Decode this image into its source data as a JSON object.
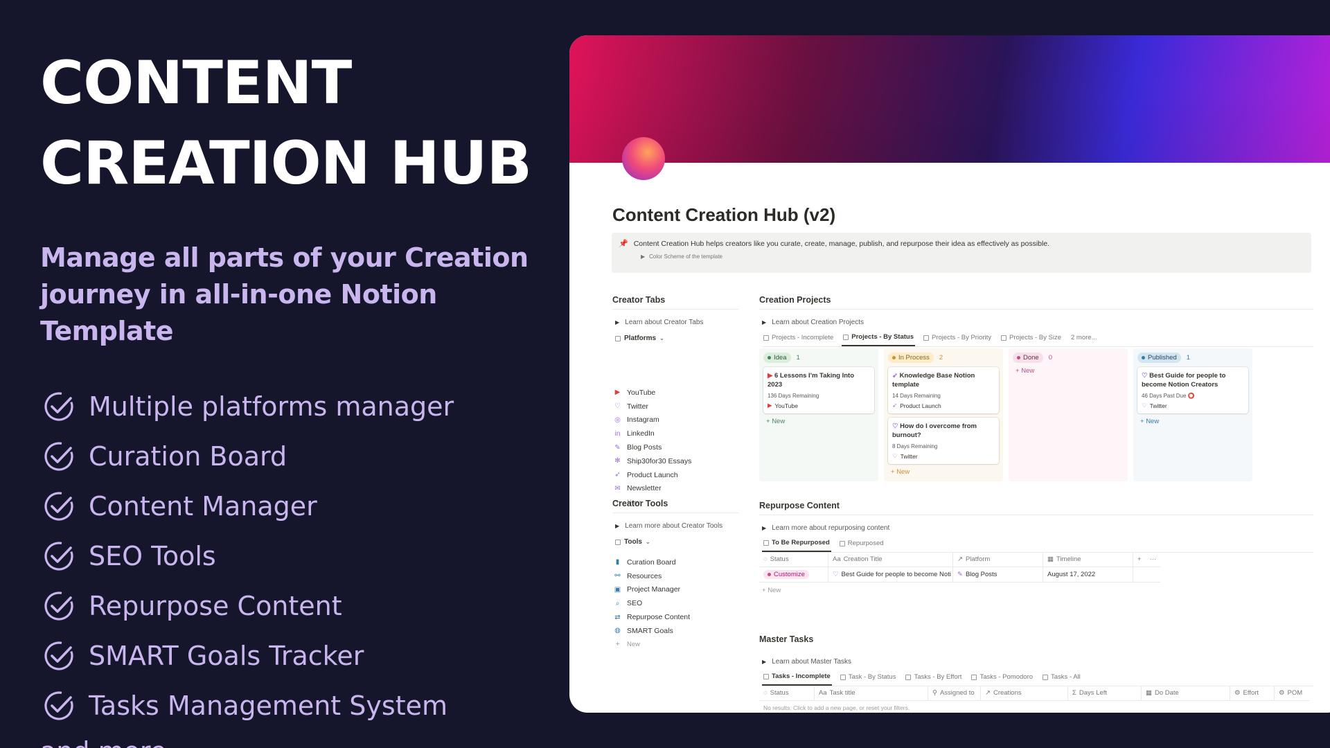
{
  "promo": {
    "title_line1": "CONTENT",
    "title_line2": "CREATION HUB",
    "subtitle": "Manage all parts of your Creation journey in all-in-one Notion Template",
    "features": [
      "Multiple platforms manager",
      "Curation Board",
      "Content Manager",
      "SEO Tools",
      "Repurpose Content",
      "SMART Goals Tracker",
      "Tasks Management System"
    ],
    "more": "and more..."
  },
  "colors": {
    "background": "#15162b",
    "accent": "#c9b6ee"
  },
  "page": {
    "title": "Content Creation Hub (v2)",
    "callout_text": "Content Creation Hub helps creators like you curate, create, manage, publish, and repurpose their idea as effectively as possible.",
    "callout_toggle": "Color Scheme of the template"
  },
  "creator_tabs": {
    "heading": "Creator Tabs",
    "toggle": "Learn about Creator Tabs",
    "view": "Platforms",
    "items": [
      {
        "label": "YouTube",
        "icon": "youtube-icon"
      },
      {
        "label": "Twitter",
        "icon": "twitter-icon"
      },
      {
        "label": "Instagram",
        "icon": "instagram-icon"
      },
      {
        "label": "LinkedIn",
        "icon": "linkedin-icon"
      },
      {
        "label": "Blog Posts",
        "icon": "pen-icon"
      },
      {
        "label": "Ship30for30 Essays",
        "icon": "snowflake-icon"
      },
      {
        "label": "Product Launch",
        "icon": "rocket-icon"
      },
      {
        "label": "Newsletter",
        "icon": "mail-icon"
      }
    ],
    "new_label": "New"
  },
  "creator_tools": {
    "heading": "Creator Tools",
    "toggle": "Learn more about Creator Tools",
    "view": "Tools",
    "items": [
      {
        "label": "Curation Board",
        "icon": "bookmark-icon"
      },
      {
        "label": "Resources",
        "icon": "link-icon"
      },
      {
        "label": "Project Manager",
        "icon": "briefcase-icon"
      },
      {
        "label": "SEO",
        "icon": "search-icon"
      },
      {
        "label": "Repurpose Content",
        "icon": "repeat-icon"
      },
      {
        "label": "SMART Goals",
        "icon": "globe-icon"
      }
    ],
    "new_label": "New"
  },
  "creation_projects": {
    "heading": "Creation Projects",
    "toggle": "Learn about Creation Projects",
    "tabs": [
      "Projects - Incomplete",
      "Projects - By Status",
      "Projects - By Priority",
      "Projects - By Size",
      "2 more..."
    ],
    "active_tab": 1,
    "columns": [
      {
        "name": "Idea",
        "count": "1",
        "bg": "#f5f9f6",
        "pill": "#dbeddb",
        "dot": "#448361",
        "text": "#2b593f",
        "new": "#448361",
        "cards": [
          {
            "title": "6 Lessons I'm Taking Into 2023",
            "meta": "136 Days Remaining",
            "platform": "YouTube"
          }
        ]
      },
      {
        "name": "In Process",
        "count": "2",
        "bg": "#fcf7ef",
        "pill": "#fdecc8",
        "dot": "#cb912f",
        "text": "#89632a",
        "new": "#cb912f",
        "cards": [
          {
            "title": "Knowledge Base Notion template",
            "meta": "14 Days Remaining",
            "platform": "Product Launch"
          },
          {
            "title": "How do I overcome from burnout?",
            "meta": "8 Days Remaining",
            "platform": "Twitter"
          }
        ]
      },
      {
        "name": "Done",
        "count": "0",
        "bg": "#fdf5f8",
        "pill": "#f5e0e9",
        "dot": "#c14c8a",
        "text": "#69314c",
        "new": "#c14c8a",
        "cards": []
      },
      {
        "name": "Published",
        "count": "1",
        "bg": "#f4f8fb",
        "pill": "#d3e5ef",
        "dot": "#337ea9",
        "text": "#28456c",
        "new": "#337ea9",
        "cards": [
          {
            "title": "Best Guide for people to become Notion Creators",
            "meta": "46 Days Past Due",
            "platform": "Twitter"
          }
        ]
      }
    ],
    "new_label": "New"
  },
  "repurpose": {
    "heading": "Repurpose Content",
    "toggle": "Learn more about repurposing content",
    "tabs": [
      "To Be Repurposed",
      "Repurposed"
    ],
    "headers": [
      "Status",
      "Creation Title",
      "Platform",
      "Timeline"
    ],
    "rows": [
      {
        "status": "Customize",
        "title": "Best Guide for people to become Noti",
        "platform": "Blog Posts",
        "timeline": "August 17, 2022"
      }
    ],
    "new_label": "New"
  },
  "master_tasks": {
    "heading": "Master Tasks",
    "toggle": "Learn about Master Tasks",
    "tabs": [
      "Tasks - Incomplete",
      "Task - By Status",
      "Tasks - By Effort",
      "Tasks - Pomodoro",
      "Tasks - All"
    ],
    "headers": [
      "Status",
      "Task title",
      "Assigned to",
      "Creations",
      "Days Left",
      "Do Date",
      "Effort",
      "POM"
    ],
    "empty": "No results. Click to add a new page, or reset your filters."
  }
}
